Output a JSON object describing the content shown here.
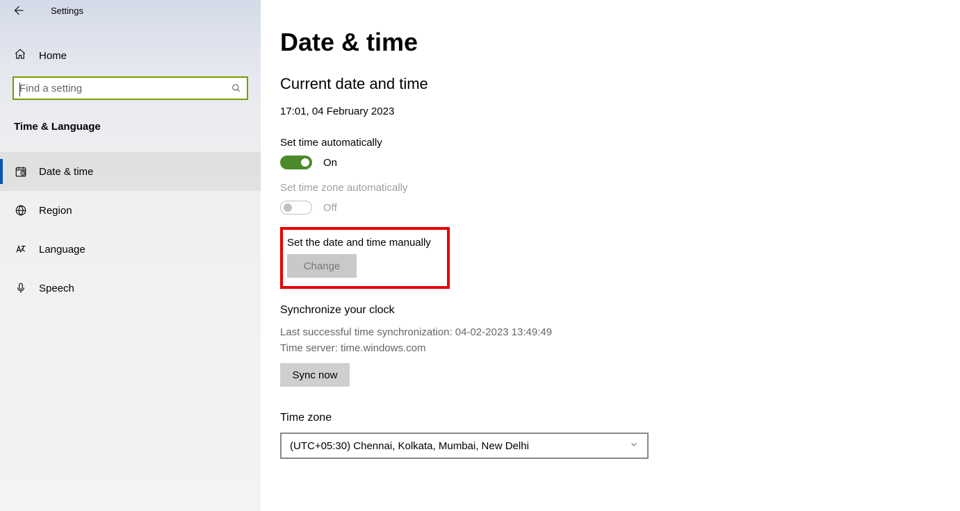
{
  "header": {
    "title": "Settings"
  },
  "sidebar": {
    "home_label": "Home",
    "search_placeholder": "Find a setting",
    "category": "Time & Language",
    "items": [
      {
        "label": "Date & time"
      },
      {
        "label": "Region"
      },
      {
        "label": "Language"
      },
      {
        "label": "Speech"
      }
    ]
  },
  "main": {
    "page_title": "Date & time",
    "section_title": "Current date and time",
    "datetime": "17:01, 04 February 2023",
    "auto_time": {
      "label": "Set time automatically",
      "state": "On"
    },
    "auto_tz": {
      "label": "Set time zone automatically",
      "state": "Off"
    },
    "manual": {
      "label": "Set the date and time manually",
      "button": "Change"
    },
    "sync": {
      "title": "Synchronize your clock",
      "last_line": "Last successful time synchronization: 04-02-2023 13:49:49",
      "server_line": "Time server: time.windows.com",
      "button": "Sync now"
    },
    "timezone": {
      "title": "Time zone",
      "value": "(UTC+05:30) Chennai, Kolkata, Mumbai, New Delhi"
    }
  }
}
